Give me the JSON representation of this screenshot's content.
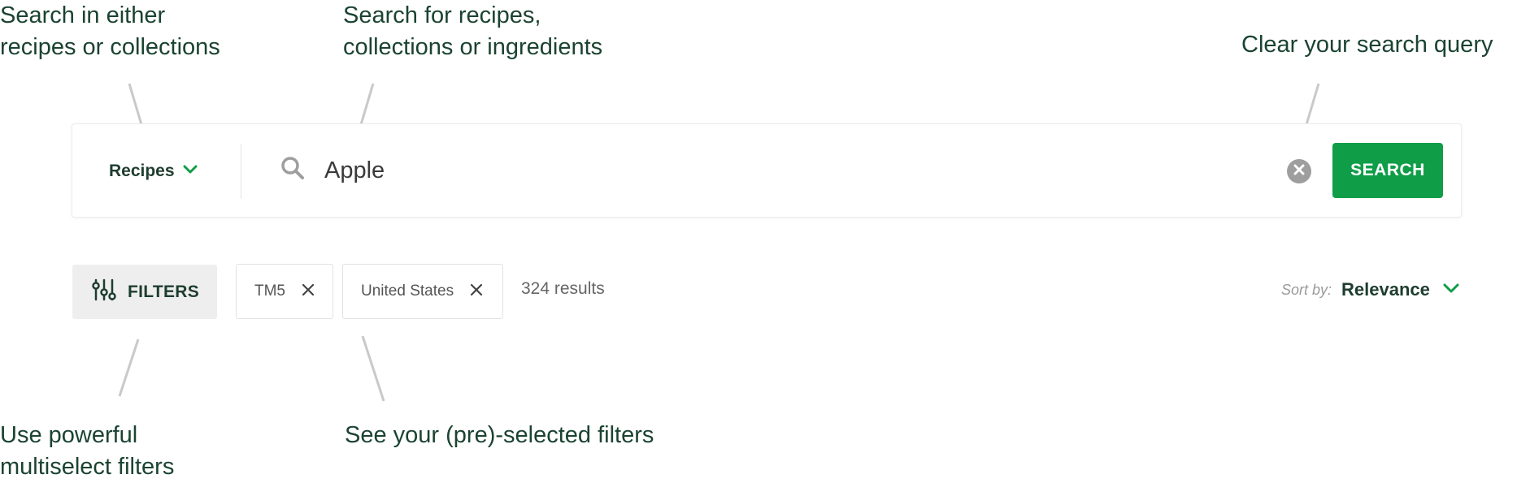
{
  "annotations": {
    "scope": [
      "Search in either",
      "recipes or collections"
    ],
    "search": [
      "Search for recipes,",
      "collections or ingredients"
    ],
    "clear": [
      "Clear your search query"
    ],
    "filters": [
      "Use powerful",
      "multiselect filters"
    ],
    "chips": [
      "See your (pre)-selected filters"
    ]
  },
  "search_bar": {
    "scope_label": "Recipes",
    "query_value": "Apple",
    "search_button": "SEARCH"
  },
  "filter_bar": {
    "filters_button": "FILTERS",
    "chips": [
      {
        "label": "TM5"
      },
      {
        "label": "United States"
      }
    ],
    "results_text": "324 results",
    "sort_prefix": "Sort by:",
    "sort_value": "Relevance"
  },
  "icons": {
    "scope_chevron": "chevron-down-icon",
    "search": "search-icon",
    "clear": "close-circle-icon",
    "filters": "sliders-icon",
    "chip_remove": "close-icon",
    "sort_chevron": "chevron-down-icon"
  },
  "colors": {
    "accent_green": "#0f9d48",
    "text_dark_green": "#1b4332",
    "muted_gray": "#9e9e9e"
  }
}
